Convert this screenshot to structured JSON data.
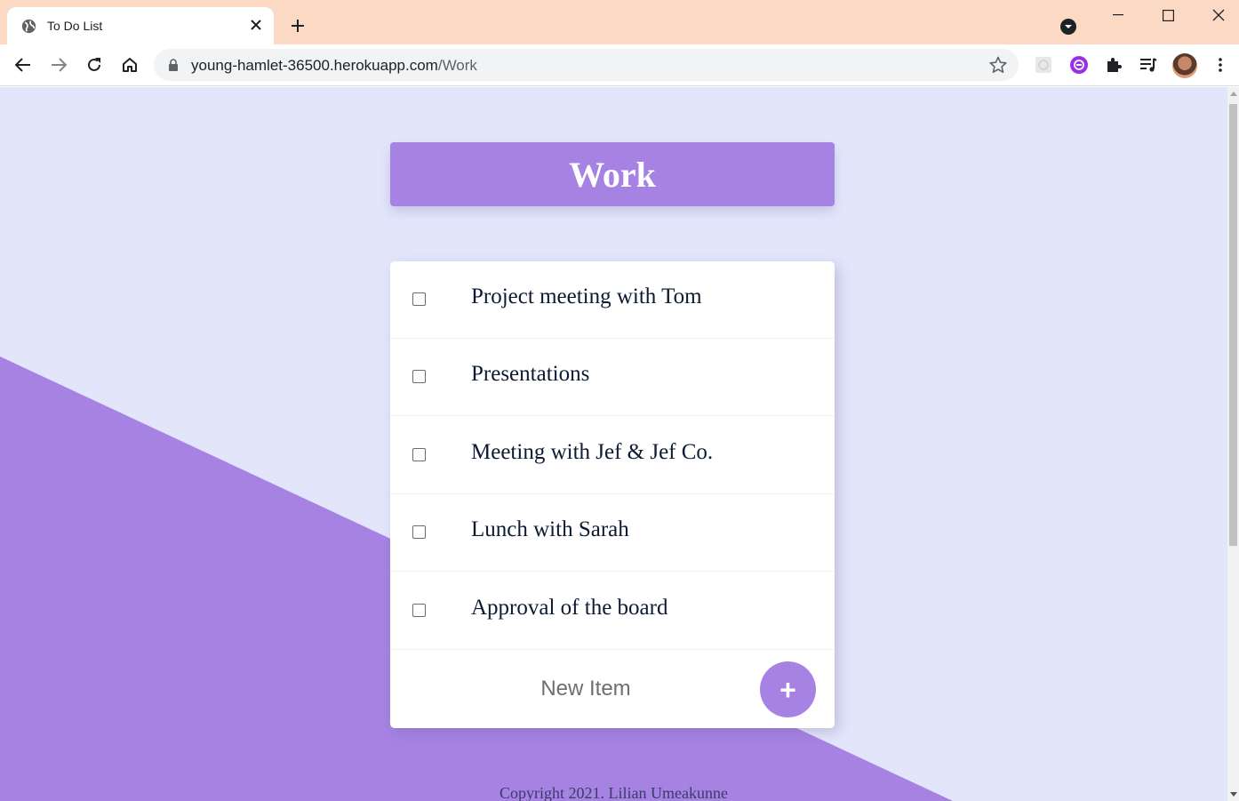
{
  "browser": {
    "tab_title": "To Do List",
    "url_host": "young-hamlet-36500.herokuapp.com",
    "url_path": "/Work",
    "colors": {
      "tabstrip": "#fcd9c5",
      "accent": "#a683e3"
    }
  },
  "page": {
    "heading": "Work",
    "items": [
      {
        "label": "Project meeting with Tom",
        "checked": false
      },
      {
        "label": "Presentations",
        "checked": false
      },
      {
        "label": "Meeting with Jef & Jef Co.",
        "checked": false
      },
      {
        "label": "Lunch with Sarah",
        "checked": false
      },
      {
        "label": "Approval of the board",
        "checked": false
      }
    ],
    "new_item_placeholder": "New Item",
    "add_button_label": "+",
    "footer": "Copyright 2021. Lilian Umeakunne",
    "colors": {
      "background": "#e3e6fb",
      "purple": "#a683e3",
      "text": "#0c1b33"
    }
  }
}
